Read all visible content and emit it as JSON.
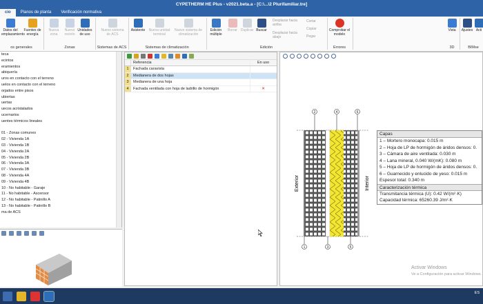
{
  "window": {
    "title": "CYPETHERM HE Plus - v2021.beta.a - [C:\\...\\2 Plurifamiliar.tre]"
  },
  "tabs": [
    {
      "label": "cio"
    },
    {
      "label": "Planos de planta"
    },
    {
      "label": "Verificación normativa"
    }
  ],
  "ribbon": {
    "buttons": {
      "datos_emplazamiento": "Datos del emplazamiento",
      "fuentes_energia": "Fuentes de energía",
      "nueva_zona": "Nueva zona",
      "nuevo_recinto": "Nuevo recinto",
      "unidades_uso": "Unidades de uso",
      "nuevo_sistema_acs": "Nuevo sistema de ACS",
      "asistente": "Asistente",
      "nueva_unidad_terminal": "Nueva unidad terminal",
      "nuevo_sistema_clima": "Nuevo sistema de climatización",
      "edicion_multiple": "Edición múltiple",
      "borrar": "Borrar",
      "duplicar": "Duplicar",
      "buscar": "Buscar",
      "desplazar_arriba": "Desplazar hacia arriba",
      "desplazar_abajo": "Desplazar hacia abajo",
      "cortar": "Cortar",
      "copiar": "Copiar",
      "pegar": "Pegar",
      "comprobar_modelo": "Comprobar el modelo",
      "vista": "Vista",
      "ajustes": "Ajustes",
      "acti": "Acti"
    },
    "groups": {
      "datos_generales": "os generales",
      "zonas": "Zonas",
      "sistemas_acs": "Sistemas de ACS",
      "sistemas_clima": "Sistemas de climatización",
      "edicion": "Edición",
      "errores": "Errores",
      "three_d": "3D",
      "bim": "BIMse"
    }
  },
  "tree": {
    "items": [
      "teca",
      "ecintos",
      "eramientos",
      "abiquería",
      "uros en contacto con el terreno",
      "uelos en contacto con el terreno",
      "orjados entre pisos",
      "ubiertas",
      "uertas",
      "uecos acristalados",
      "ucernarios",
      "uentes térmicos lineales",
      "",
      "01 - Zonas comunes",
      "02 - Vivienda 1A",
      "03 - Vivienda 1B",
      "04 - Vivienda 2A",
      "05 - Vivienda 2B",
      "06 - Vivienda 3A",
      "07 - Vivienda 3B",
      "08 - Vivienda 4A",
      "09 - Vivienda 4B",
      "10 - No habitable - Garaje",
      "11 - No habitable - Ascensor",
      "12 - No habitable - Patinillo A",
      "13 - No habitable - Patinillo B",
      "ma de ACS"
    ]
  },
  "table": {
    "headers": {
      "num": "",
      "ref": "Referencia",
      "use": "En uso"
    },
    "rows": [
      {
        "num": "1",
        "ref": "Fachada caravista",
        "use": ""
      },
      {
        "num": "2",
        "ref": "Medianera de dos hojas",
        "use": ""
      },
      {
        "num": "3",
        "ref": "Medianera de una hoja",
        "use": ""
      },
      {
        "num": "4",
        "ref": "Fachada ventilada con hoja de ladrillo de hormigón",
        "use": "✕"
      }
    ]
  },
  "section": {
    "side_left": "Exterior",
    "side_right": "Interior",
    "markers_top": [
      "2",
      "4",
      "6"
    ],
    "markers_bottom": [
      "1",
      "3",
      "5"
    ]
  },
  "capas": {
    "title": "Capas",
    "lines": [
      "1 – Mortero monocapa: 0.015 m",
      "2 – Hoja de LP de hormigón de áridos densos: 0.",
      "3 – Cámara de aire ventilada: 0.030 m",
      "4 – Lana mineral, 0.040 W/(mK): 0.080 m",
      "5 – Hoja de LP de hormigón de áridos densos: 0.",
      "6 – Guarnecido y enlucido de yeso: 0.015 m",
      "Espesor total: 0.340 m"
    ]
  },
  "termica": {
    "title": "Caracterización térmica",
    "lines": [
      "Transmitancia térmica (U): 0.42 W/(m²·K)",
      "Capacidad térmica: 65260.39 J/m²·K"
    ]
  },
  "watermark": {
    "line1": "Activar Windows",
    "line2": "Ve a Configuración para activar Windows."
  },
  "tray": {
    "lang": "ES"
  },
  "colors": {
    "titlebar": "#2e63a8",
    "insulation": "#f3e632",
    "brick": "#555555",
    "selected_row": "#cfe3f7"
  }
}
